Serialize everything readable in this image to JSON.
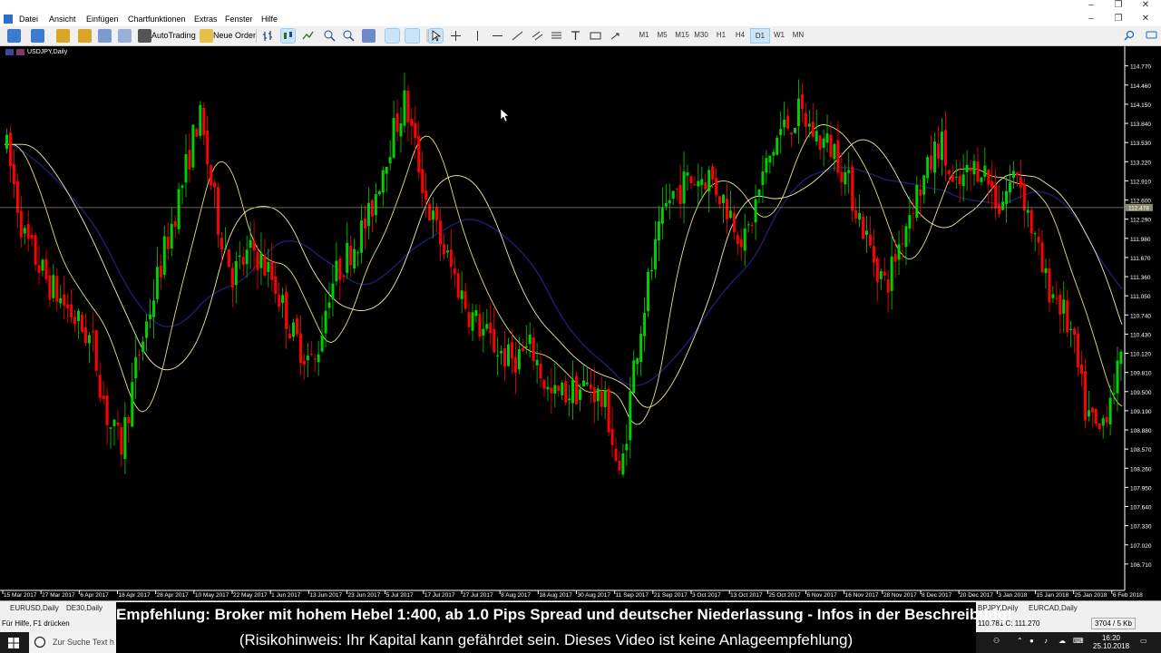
{
  "window": {
    "menu": [
      "Datei",
      "Ansicht",
      "Einfügen",
      "Chartfunktionen",
      "Extras",
      "Fenster",
      "Hilfe"
    ]
  },
  "toolbar": {
    "autotrading_label": "AutoTrading",
    "neworder_label": "Neue Order",
    "timeframes": [
      "M1",
      "M5",
      "M15",
      "M30",
      "H1",
      "H4",
      "D1",
      "W1",
      "MN"
    ],
    "selected_timeframe": "D1"
  },
  "chart": {
    "symbol_title": "USDJPY,Daily",
    "price_labels": [
      "114.770",
      "114.460",
      "114.150",
      "113.840",
      "113.530",
      "113.220",
      "112.910",
      "112.600",
      "112.290",
      "111.980",
      "111.670",
      "111.360",
      "111.050",
      "110.740",
      "110.430",
      "110.120",
      "109.810",
      "109.500",
      "109.190",
      "108.880",
      "108.570",
      "108.260",
      "107.950",
      "107.640",
      "107.330",
      "107.020",
      "106.710"
    ],
    "current_price_label": "112.478",
    "date_labels": [
      "15 Mar 2017",
      "27 Mar 2017",
      "6 Apr 2017",
      "18 Apr 2017",
      "28 Apr 2017",
      "10 May 2017",
      "22 May 2017",
      "1 Jun 2017",
      "13 Jun 2017",
      "23 Jun 2017",
      "5 Jul 2017",
      "17 Jul 2017",
      "27 Jul 2017",
      "8 Aug 2017",
      "18 Aug 2017",
      "30 Aug 2017",
      "11 Sep 2017",
      "21 Sep 2017",
      "3 Oct 2017",
      "13 Oct 2017",
      "25 Oct 2017",
      "6 Nov 2017",
      "16 Nov 2017",
      "28 Nov 2017",
      "8 Dec 2017",
      "20 Dec 2017",
      "3 Jan 2018",
      "15 Jan 2018",
      "25 Jan 2018",
      "6 Feb 2018"
    ],
    "colors": {
      "background": "#000000",
      "bull": "#00d000",
      "bear": "#ff0000",
      "ma_fast": "#e8e07a",
      "ma_slow": "#f0eeb0",
      "ma_long": "#1c1c6a",
      "grid_text": "#ffffff",
      "price_line": "#8a8a6a"
    }
  },
  "chart_data": {
    "type": "candlestick",
    "title": "USDJPY,Daily",
    "xlabel": "",
    "ylabel": "",
    "ylim": [
      106.4,
      115.0
    ],
    "date_range": [
      "15 Mar 2017",
      "6 Feb 2018"
    ],
    "current_price": 112.478
  },
  "tabs": [
    "EURUSD,Daily",
    "DE30,Daily",
    "BPJPY,Daily",
    "EURCAD,Daily"
  ],
  "statusbar": {
    "help": "Für Hilfe, F1 drücken",
    "right1": "110.781   C: 111.270",
    "right2": "3704 / 5 Kb"
  },
  "taskbar": {
    "search_placeholder": "Zur Suche Text h",
    "time": "16:20",
    "date": "25.10.2018"
  },
  "banner": {
    "line1": "Empfehlung: Broker mit hohem Hebel 1:400, ab 1.0 Pips Spread und deutscher Niederlassung - Infos in der Beschreibung!",
    "line2": "(Risikohinweis: Ihr Kapital kann gefährdet sein. Dieses Video ist keine Anlageempfehlung)"
  }
}
